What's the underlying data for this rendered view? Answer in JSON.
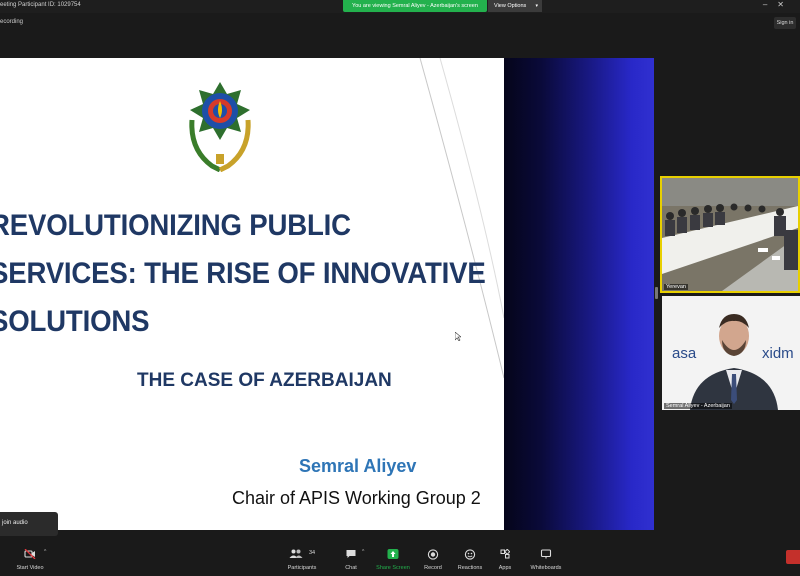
{
  "top_bar": {
    "meeting_id": "eeting Participant ID: 1029754",
    "viewing_text": "You are viewing Semral Aliyev - Azerbaijan's screen",
    "view_options_label": "View Options",
    "recording_label": "ecording",
    "sign_in_label": "Sign in"
  },
  "slide": {
    "title_lines": [
      "REVOLUTIONIZING PUBLIC",
      "SERVICES: THE RISE OF INNOVATIVE",
      "SOLUTIONS"
    ],
    "subtitle": "THE CASE OF AZERBAIJAN",
    "presenter_name": "Semral Aliyev",
    "presenter_role": "Chair of APIS Working Group 2",
    "colors": {
      "title": "#1f3864",
      "name": "#2e75b6",
      "accent_band": "#2828c8"
    }
  },
  "thumbnails": {
    "yerevan_label": "Yerevan",
    "speaker_label": "Semral Aliyev - Azerbaijan",
    "speaker_backdrop_left": "asa",
    "speaker_backdrop_right": "xidm"
  },
  "audio_popup": {
    "label": "join audio"
  },
  "toolbar": {
    "participants_count": "34",
    "items": [
      {
        "label": "Start Video",
        "icon": "video-off-icon"
      },
      {
        "label": "Participants",
        "icon": "participants-icon"
      },
      {
        "label": "Chat",
        "icon": "chat-icon"
      },
      {
        "label": "Share Screen",
        "icon": "share-screen-icon"
      },
      {
        "label": "Record",
        "icon": "record-icon"
      },
      {
        "label": "Reactions",
        "icon": "reactions-icon"
      },
      {
        "label": "Apps",
        "icon": "apps-icon"
      },
      {
        "label": "Whiteboards",
        "icon": "whiteboard-icon"
      }
    ],
    "share_color": "#23b14d"
  }
}
